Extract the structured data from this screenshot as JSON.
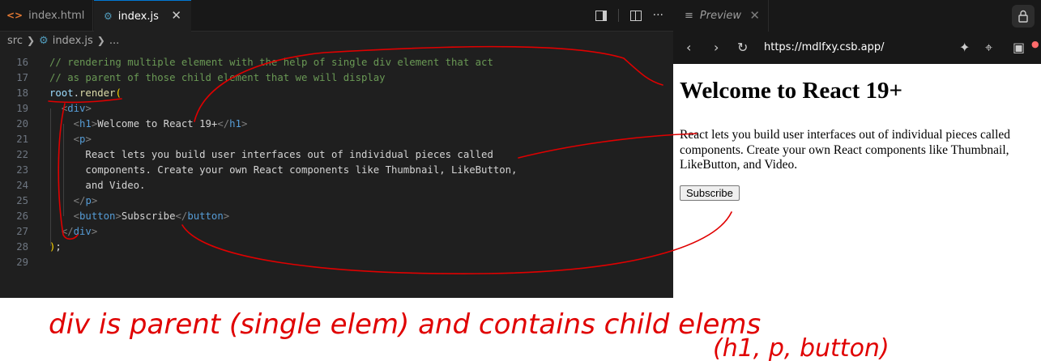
{
  "editor": {
    "tabs": [
      {
        "label": "index.html",
        "icon": "html-file-icon"
      },
      {
        "label": "index.js",
        "icon": "js-file-icon",
        "active": true
      }
    ],
    "close_glyph": "✕",
    "more_glyph": "···",
    "breadcrumb": {
      "folder": "src",
      "file": "index.js",
      "tail": "..."
    },
    "lines": [
      {
        "n": "16",
        "html": "<span class=\"cm\">// rendering multiple element with the help of single div element that act</span>"
      },
      {
        "n": "17",
        "html": "<span class=\"cm\">// as parent of those child element that we will display</span>"
      },
      {
        "n": "18",
        "html": "<span class=\"vr\">root</span><span class=\"tx\">.</span><span class=\"fn\">render</span><span class=\"pn\">(</span>"
      },
      {
        "n": "19",
        "html": "  <span class=\"br\">&lt;</span><span class=\"tg\">div</span><span class=\"br\">&gt;</span>"
      },
      {
        "n": "20",
        "html": "    <span class=\"br\">&lt;</span><span class=\"tg\">h1</span><span class=\"br\">&gt;</span><span class=\"tx\">Welcome to React 19+</span><span class=\"br\">&lt;/</span><span class=\"tg\">h1</span><span class=\"br\">&gt;</span>"
      },
      {
        "n": "21",
        "html": "    <span class=\"br\">&lt;</span><span class=\"tg\">p</span><span class=\"br\">&gt;</span>"
      },
      {
        "n": "22",
        "html": "      <span class=\"tx\">React lets you build user interfaces out of individual pieces called</span>"
      },
      {
        "n": "23",
        "html": "      <span class=\"tx\">components. Create your own React components like Thumbnail, LikeButton,</span>"
      },
      {
        "n": "24",
        "html": "      <span class=\"tx\">and Video.</span>"
      },
      {
        "n": "25",
        "html": "    <span class=\"br\">&lt;/</span><span class=\"tg\">p</span><span class=\"br\">&gt;</span>"
      },
      {
        "n": "26",
        "html": "    <span class=\"br\">&lt;</span><span class=\"tg\">button</span><span class=\"br\">&gt;</span><span class=\"tx\">Subscribe</span><span class=\"br\">&lt;/</span><span class=\"tg\">button</span><span class=\"br\">&gt;</span>"
      },
      {
        "n": "27",
        "html": "  <span class=\"br\">&lt;/</span><span class=\"tg\">div</span><span class=\"br\">&gt;</span>"
      },
      {
        "n": "28",
        "html": "<span class=\"pn\">)</span><span class=\"tx\">;</span>"
      },
      {
        "n": "29",
        "html": ""
      }
    ]
  },
  "preview": {
    "tab_label": "Preview",
    "url": "https://mdlfxy.csb.app/",
    "heading": "Welcome to React 19+",
    "paragraph": "React lets you build user interfaces out of individual pieces called components. Create your own React components like Thumbnail, LikeButton, and Video.",
    "button_label": "Subscribe"
  },
  "annotation": {
    "line1": "div is parent (single elem) and contains child elems",
    "line2": "(h1, p, button)",
    "ink_color": "#e00000"
  }
}
